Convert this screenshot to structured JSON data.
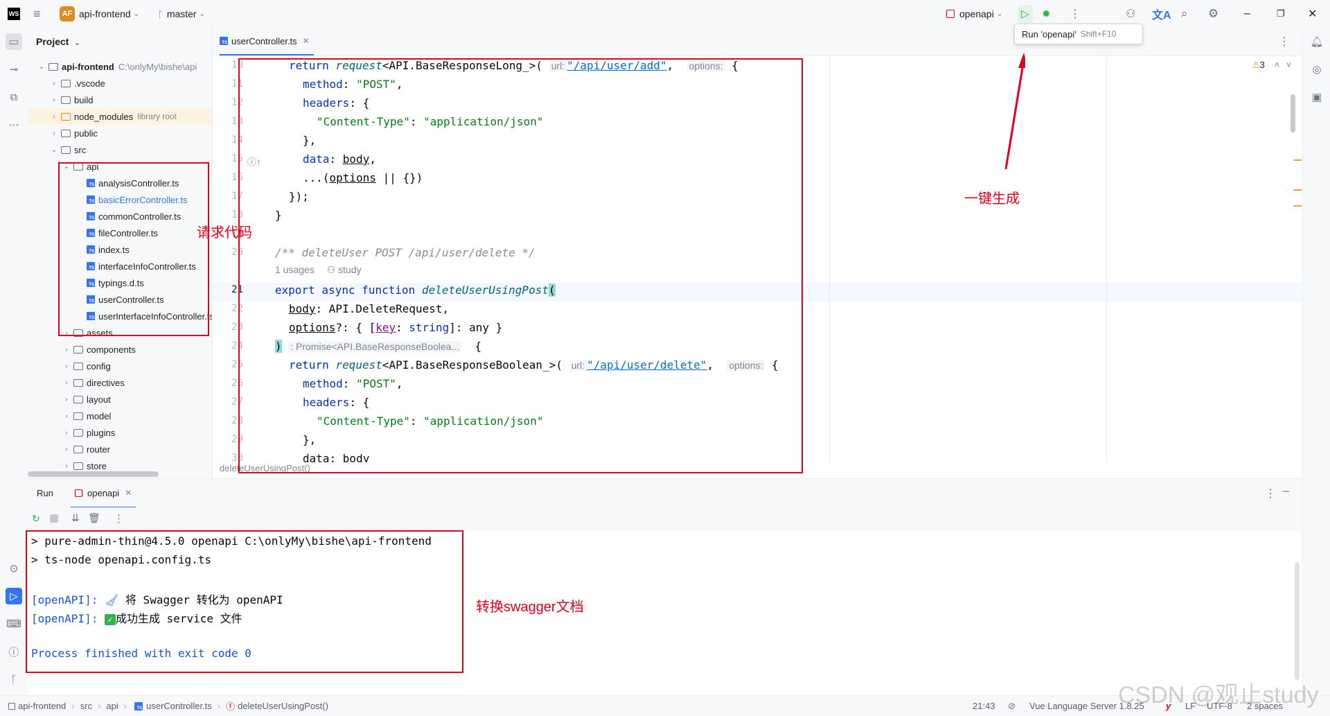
{
  "titlebar": {
    "logo": "WS",
    "project_badge": "AF",
    "project_name": "api-frontend",
    "branch": "master",
    "run_config": "openapi",
    "tooltip_label": "Run 'openapi'",
    "tooltip_shortcut": "Shift+F10"
  },
  "project_panel": {
    "title": "Project",
    "tree": [
      {
        "label": "api-frontend",
        "extra": "C:\\onlyMy\\bishe\\api",
        "bold": true
      },
      {
        "label": ".vscode"
      },
      {
        "label": "build"
      },
      {
        "label": "node_modules",
        "extra": "library root"
      },
      {
        "label": "public"
      },
      {
        "label": "src"
      },
      {
        "label": "api"
      },
      {
        "label": "analysisController.ts"
      },
      {
        "label": "basicErrorController.ts"
      },
      {
        "label": "commonController.ts"
      },
      {
        "label": "fileController.ts"
      },
      {
        "label": "index.ts"
      },
      {
        "label": "interfaceInfoController.ts"
      },
      {
        "label": "typings.d.ts"
      },
      {
        "label": "userController.ts"
      },
      {
        "label": "userInterfaceInfoController.ts"
      },
      {
        "label": "assets"
      },
      {
        "label": "components"
      },
      {
        "label": "config"
      },
      {
        "label": "directives"
      },
      {
        "label": "layout"
      },
      {
        "label": "model"
      },
      {
        "label": "plugins"
      },
      {
        "label": "router"
      },
      {
        "label": "store"
      }
    ]
  },
  "editor": {
    "tab_label": "userController.ts",
    "warnings": "3",
    "line_numbers": [
      "10",
      "11",
      "12",
      "13",
      "14",
      "15",
      "16",
      "17",
      "18",
      "19",
      "20",
      "",
      "21",
      "22",
      "23",
      "24",
      "25",
      "26",
      "27",
      "28",
      "29",
      "30"
    ],
    "code": {
      "l10_return": "return",
      "l10_fn": "request",
      "l10_type": "<API.BaseResponseLong_>(",
      "l10_hint": "url:",
      "l10_url": "\"/api/user/add\"",
      "l10_hint2": "options:",
      "brace": "{",
      "method_key": "method",
      "method_post": "\"POST\"",
      "headers_key": "headers",
      "content_type_key": "\"Content-Type\"",
      "content_type_val": "\"application/json\"",
      "close_brace_comma": "},",
      "data_key": "data",
      "body_word": "body",
      "spread_prefix": "...(",
      "options_word": "options",
      "spread_suffix": " || {})",
      "close_call": "});",
      "close_fn": "}",
      "comment": "/** deleteUser POST /api/user/delete */",
      "usages": "1 usages",
      "author": "study",
      "export_kw": "export async function",
      "fn_name": "deleteUserUsingPost",
      "open_paren": "(",
      "param_body_type": ": API.DeleteRequest,",
      "param_options_prefix": "?: { [",
      "key_word": "key",
      "string_kw": "string",
      "any_part": "]: any }",
      "ret_paren": ")",
      "ret_hint": ": Promise<API.BaseResponseBoolea...",
      "l25_type": "<API.BaseResponseBoolean_>(",
      "l25_url": "\"/api/user/delete\"",
      "l30_partial": "data: body"
    },
    "breadcrumb": "deleteUserUsingPost()"
  },
  "run_panel": {
    "tab_run": "Run",
    "tab_config": "openapi",
    "console": [
      "> pure-admin-thin@4.5.0 openapi C:\\onlyMy\\bishe\\api-frontend",
      "> ts-node openapi.config.ts",
      "",
      "[openAPI]:",
      "将 Swagger 转化为 openAPI",
      "[openAPI]:",
      "成功生成 service 文件",
      "",
      "Process finished with exit code 0"
    ]
  },
  "annotations": {
    "request_code": "请求代码",
    "one_click": "一键生成",
    "convert_swagger": "转换swagger文档"
  },
  "statusbar": {
    "crumbs": [
      "api-frontend",
      "src",
      "api",
      "userController.ts",
      "deleteUserUsingPost()"
    ],
    "position": "21:43",
    "language_server": "Vue Language Server 1.8.25",
    "line_sep": "LF",
    "encoding": "UTF-8",
    "indent": "2 spaces"
  },
  "watermark": "CSDN @观止study",
  "colors": {
    "accent": "#3574f0",
    "annotation_red": "#e0001b",
    "run_green": "#2fb24a"
  }
}
